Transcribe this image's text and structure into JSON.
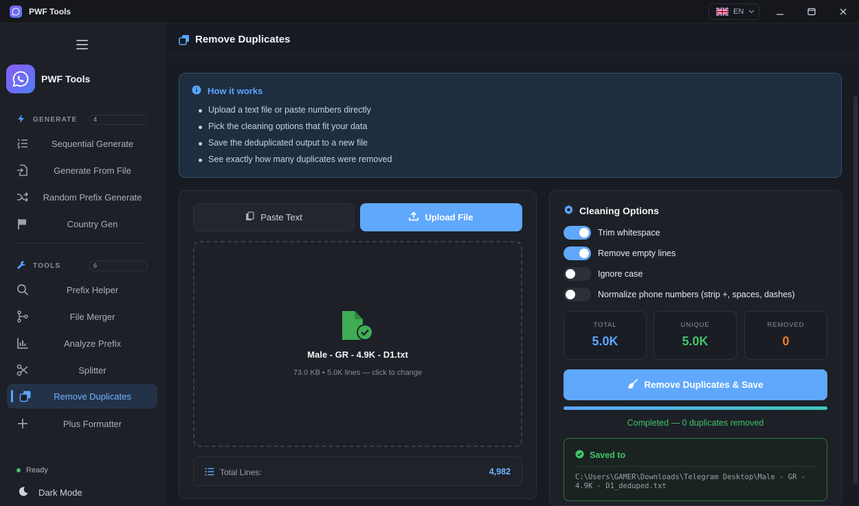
{
  "window": {
    "title": "PWF Tools",
    "language": "EN"
  },
  "sidebar": {
    "brand": "PWF Tools",
    "generate_section": {
      "label": "GENERATE",
      "count": "4"
    },
    "generate_items": [
      {
        "label": "Sequential Generate",
        "icon": "list-numbered-icon"
      },
      {
        "label": "Generate From File",
        "icon": "file-import-icon"
      },
      {
        "label": "Random Prefix Generate",
        "icon": "shuffle-icon"
      },
      {
        "label": "Country Gen",
        "icon": "flag-icon"
      }
    ],
    "tools_section": {
      "label": "TOOLS",
      "count": "6"
    },
    "tools_items": [
      {
        "label": "Prefix Helper",
        "icon": "search-icon"
      },
      {
        "label": "File Merger",
        "icon": "merge-icon"
      },
      {
        "label": "Analyze Prefix",
        "icon": "bar-chart-icon"
      },
      {
        "label": "Splitter",
        "icon": "scissors-icon"
      },
      {
        "label": "Remove Duplicates",
        "icon": "copy-icon",
        "active": true
      },
      {
        "label": "Plus Formatter",
        "icon": "plus-icon"
      }
    ],
    "status": "Ready",
    "dark_mode": "Dark Mode"
  },
  "page": {
    "title": "Remove Duplicates"
  },
  "how_it_works": {
    "title": "How it works",
    "steps": [
      "Upload a text file or paste numbers directly",
      "Pick the cleaning options that fit your data",
      "Save the deduplicated output to a new file",
      "See exactly how many duplicates were removed"
    ]
  },
  "input": {
    "tab_paste": "Paste Text",
    "tab_upload": "Upload File",
    "file_name": "Male - GR - 4.9K - D1.txt",
    "file_meta": "73.0 KB • 5.0K lines — click to change",
    "total_label": "Total Lines:",
    "total_value": "4,982"
  },
  "options": {
    "title": "Cleaning Options",
    "items": [
      {
        "label": "Trim whitespace",
        "on": true
      },
      {
        "label": "Remove empty lines",
        "on": true
      },
      {
        "label": "Ignore case",
        "on": false
      },
      {
        "label": "Normalize phone numbers (strip +, spaces, dashes)",
        "on": false
      }
    ],
    "stats": [
      {
        "label": "TOTAL",
        "value": "5.0K",
        "color": "#5aa6ff"
      },
      {
        "label": "UNIQUE",
        "value": "5.0K",
        "color": "#3fc46a"
      },
      {
        "label": "REMOVED",
        "value": "0",
        "color": "#f07b2e"
      }
    ],
    "action": "Remove Duplicates & Save",
    "progress": 1.0,
    "completed": "Completed — 0 duplicates removed",
    "saved_title": "Saved to",
    "saved_path": "C:\\Users\\GAMER\\Downloads\\Telegram Desktop\\Male - GR - 4.9K - D1_deduped.txt"
  },
  "colors": {
    "accent": "#5fa8fb",
    "success": "#3fc46a",
    "warning": "#f07b2e"
  }
}
